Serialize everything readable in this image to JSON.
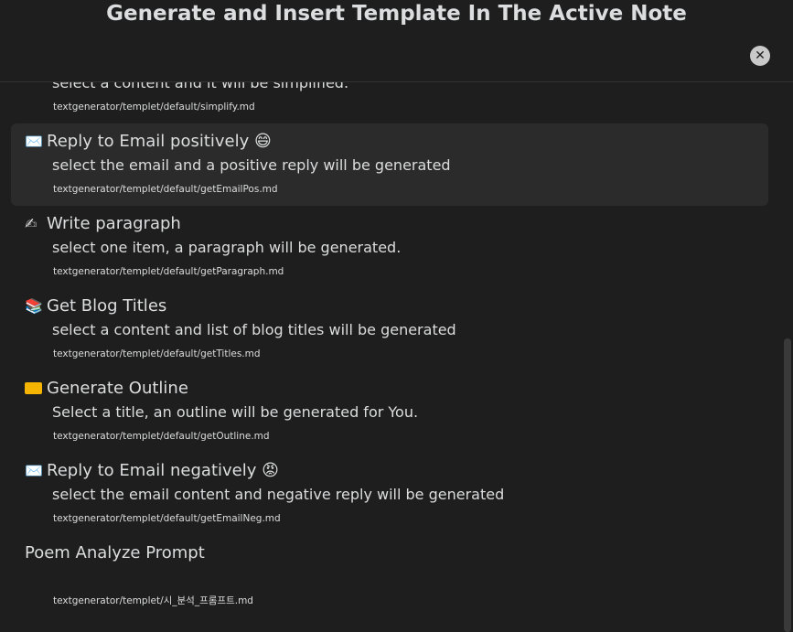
{
  "modal": {
    "title": "Generate and Insert Template In The Active Note",
    "close_label": "✕"
  },
  "items": [
    {
      "icon": "",
      "title": "",
      "description": "select a content and it will be simplified.",
      "path": "textgenerator/templet/default/simplify.md"
    },
    {
      "icon": "✉️",
      "icon_name": "envelope-icon",
      "title": "Reply to Email positively 😄",
      "description": "select the email and a positive reply will be generated",
      "path": "textgenerator/templet/default/getEmailPos.md",
      "selected": true
    },
    {
      "icon": "✍",
      "icon_name": "writing-hand-icon",
      "title": "Write paragraph",
      "description": "select one item, a paragraph will be generated.",
      "path": "textgenerator/templet/default/getParagraph.md"
    },
    {
      "icon": "📚",
      "icon_name": "books-icon",
      "title": "Get Blog Titles",
      "description": "select a content and list of blog titles will be generated",
      "path": "textgenerator/templet/default/getTitles.md"
    },
    {
      "icon": "",
      "icon_name": "outline-icon",
      "title": "Generate Outline",
      "description": "Select a title, an outline will be generated for You.",
      "path": "textgenerator/templet/default/getOutline.md"
    },
    {
      "icon": "✉️",
      "icon_name": "envelope-icon",
      "title": "Reply to Email negatively 😡",
      "description": "select the email content and negative reply will be generated",
      "path": "textgenerator/templet/default/getEmailNeg.md"
    },
    {
      "icon": "",
      "title": "Poem Analyze Prompt",
      "description": "",
      "path": "textgenerator/templet/시_분석_프롬프트.md"
    }
  ],
  "colors": {
    "background": "#1e1e1e",
    "selected_background": "#2b2b2b",
    "text": "#dcddde",
    "close_button": "#c9c9c9",
    "outline_icon": "#f5b400"
  }
}
